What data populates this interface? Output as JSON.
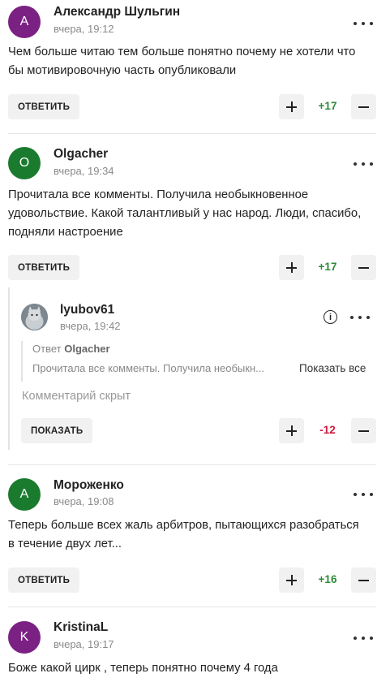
{
  "comments": [
    {
      "author": "Александр Шульгин",
      "time": "вчера, 19:12",
      "avatar_letter": "А",
      "avatar_color": "#7b2183",
      "text_lines": [
        "Чем больше читаю тем больше понятно почему не хотели что",
        "бы мотивировочную часть опубликовали"
      ],
      "reply_label": "ОТВЕТИТЬ",
      "score": "+17"
    },
    {
      "author": "Olgacher",
      "time": "вчера, 19:34",
      "avatar_letter": "O",
      "avatar_color": "#1a7a2e",
      "text_lines": [
        "Прочитала все комменты. Получила необыкновенное",
        "удовольствие. Какой талантливый у нас народ. Люди, спасибо,",
        "подняли настроение"
      ],
      "reply_label": "ОТВЕТИТЬ",
      "score": "+17"
    },
    {
      "author": "Мороженко",
      "time": "вчера, 19:08",
      "avatar_letter": "А",
      "avatar_color": "#1a7a2e",
      "text_lines": [
        "Теперь больше всех жаль арбитров, пытающихся разобраться",
        "в течение двух лет..."
      ],
      "reply_label": "ОТВЕТИТЬ",
      "score": "+16"
    },
    {
      "author": "KristinaL",
      "time": "вчера, 19:17",
      "avatar_letter": "K",
      "avatar_color": "#7b2183",
      "text_lines": [
        "Боже какой цирк , теперь понятно почему 4 года"
      ]
    }
  ],
  "reply": {
    "author": "lyubov61",
    "time": "вчера, 19:42",
    "quote_prefix": "Ответ",
    "quote_author": "Olgacher",
    "quote_text": "Прочитала все комменты. Получила необыкн...",
    "show_all_label": "Показать все",
    "hidden_text": "Комментарий скрыт",
    "show_label": "ПОКАЗАТЬ",
    "score": "-12"
  }
}
